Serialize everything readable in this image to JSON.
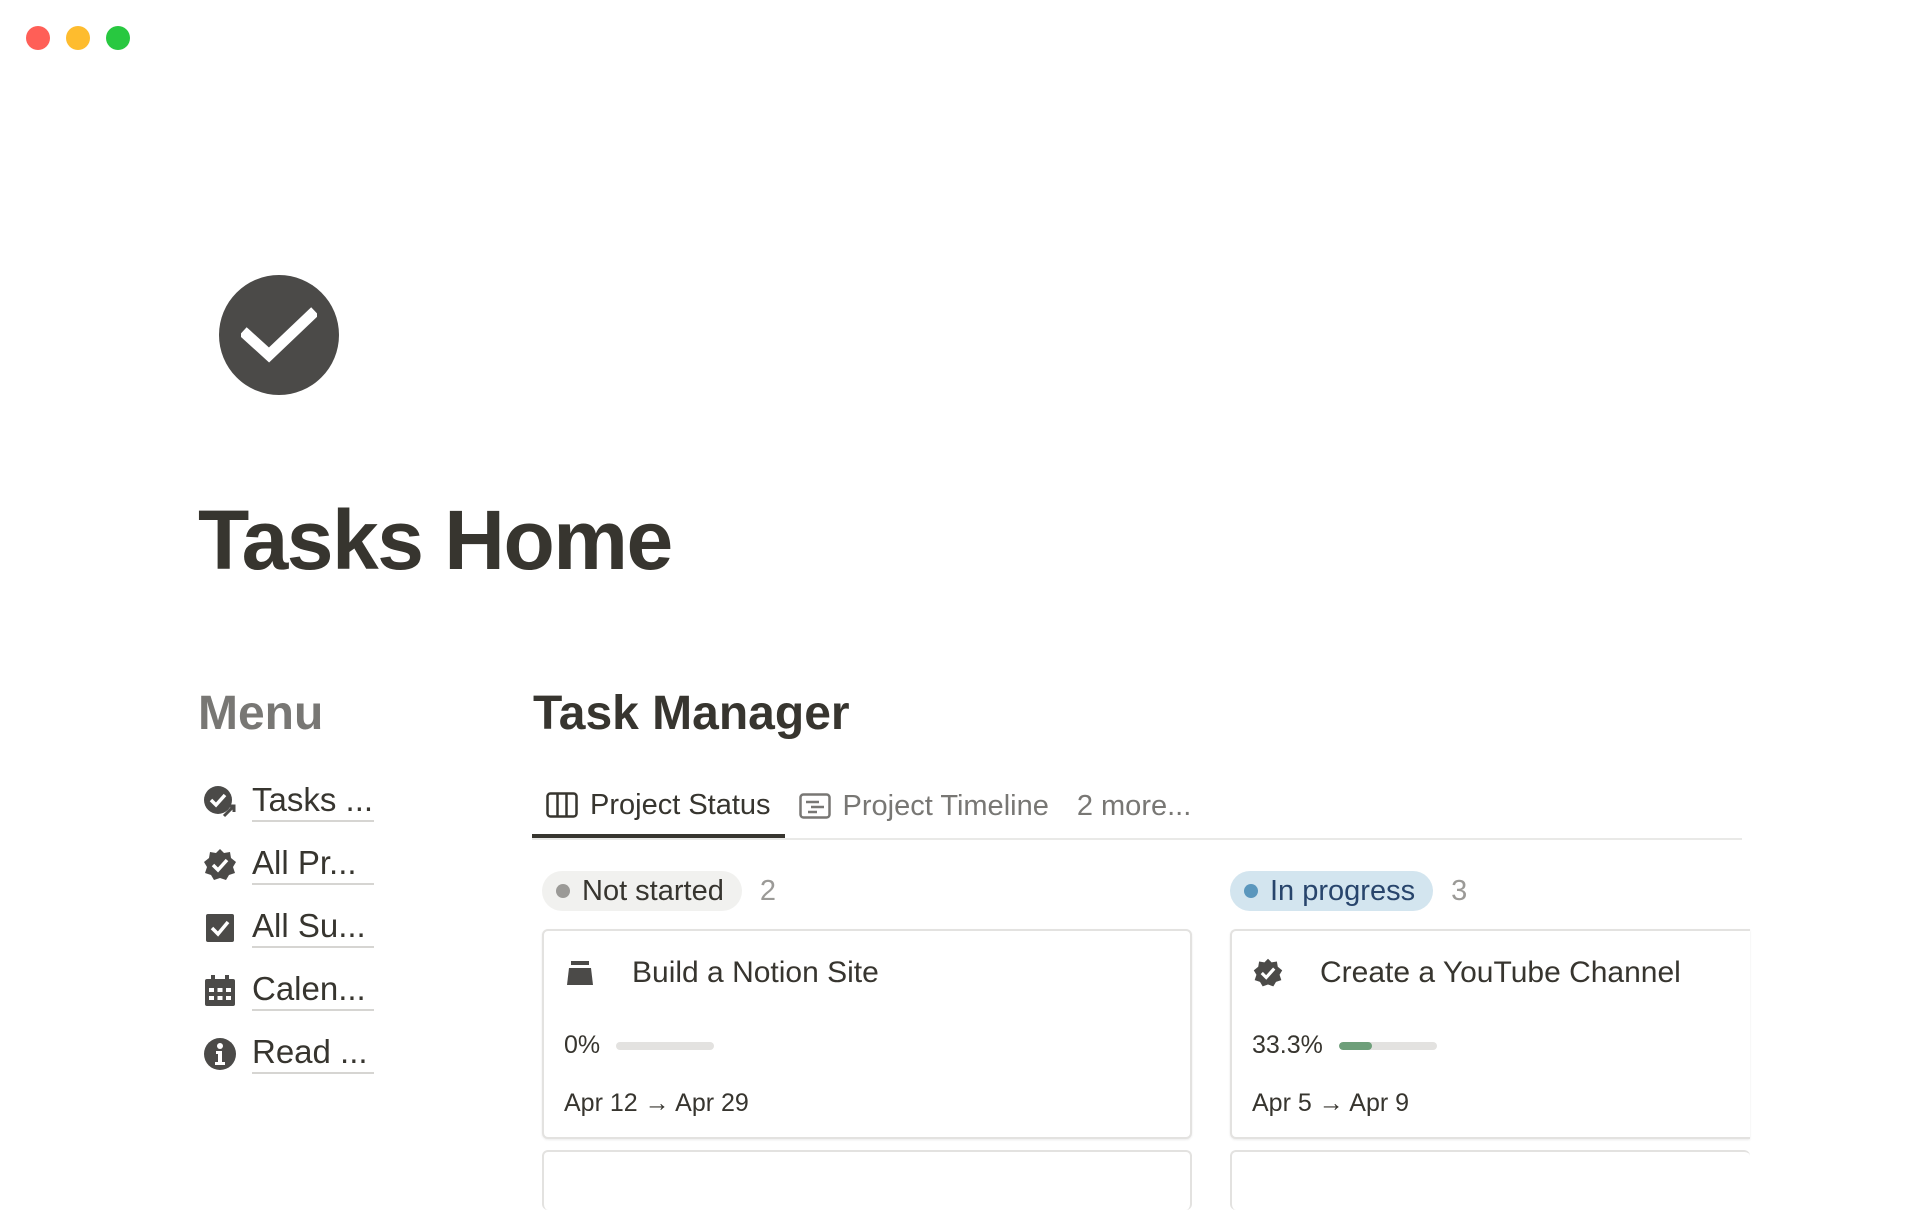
{
  "window": {
    "traffic_lights": [
      "#ff5f57",
      "#febc2e",
      "#28c840"
    ]
  },
  "page": {
    "icon": "check-circle-icon",
    "title": "Tasks Home"
  },
  "menu": {
    "heading": "Menu",
    "items": [
      {
        "label": "Tasks ...",
        "icon": "check-circle-arrow-icon"
      },
      {
        "label": "All Pr...",
        "icon": "verified-badge-icon"
      },
      {
        "label": "All Su...",
        "icon": "checkbox-icon"
      },
      {
        "label": "Calen...",
        "icon": "calendar-icon"
      },
      {
        "label": "Read ...",
        "icon": "info-icon"
      }
    ]
  },
  "task_manager": {
    "heading": "Task Manager",
    "tabs": [
      {
        "label": "Project Status",
        "icon": "board-icon",
        "active": true
      },
      {
        "label": "Project Timeline",
        "icon": "timeline-icon",
        "active": false
      },
      {
        "label": "2 more...",
        "active": false
      }
    ],
    "columns": [
      {
        "status": "Not started",
        "count": "2",
        "pill_bg": "#f1f1ef",
        "dot_color": "#9b9a97",
        "cards": [
          {
            "title": "Build a Notion Site",
            "icon": "inbox-tray-icon",
            "progress_label": "0%",
            "progress": 0.0,
            "dates": "Apr 12 → Apr 29"
          }
        ]
      },
      {
        "status": "In progress",
        "count": "3",
        "pill_bg": "#d3e5ef",
        "dot_color": "#5b97bd",
        "cards": [
          {
            "title": "Create a YouTube Channel",
            "icon": "verified-badge-icon",
            "progress_label": "33.3%",
            "progress": 0.333,
            "dates": "Apr 5 → Apr 9"
          }
        ]
      }
    ],
    "accent_progress": "#6e9f7a"
  }
}
